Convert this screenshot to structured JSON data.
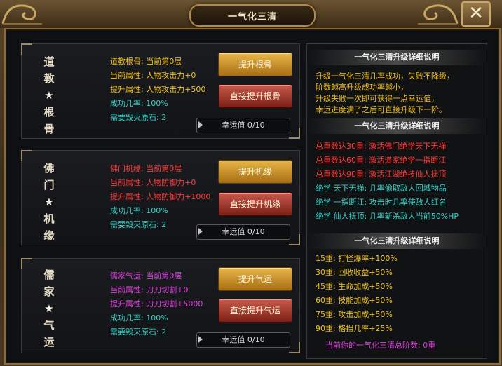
{
  "window": {
    "title": "一气化三清",
    "close_glyph": "✕"
  },
  "panels": [
    {
      "vertical_title": [
        "道",
        "教",
        "★",
        "根",
        "骨"
      ],
      "lines": [
        {
          "text": "道教根骨: 当前第0层",
          "color": "#f0c020"
        },
        {
          "text": "当前属性: 人物攻击力+0",
          "color": "#f0c020"
        },
        {
          "text": "提升属性: 人物攻击力+500",
          "color": "#f0c020"
        },
        {
          "text": "成功几率: 100%",
          "color": "#38d0c8"
        },
        {
          "text": "需要毁灭原石: 2",
          "color": "#38d0c8"
        }
      ],
      "btn_upgrade": "提升根骨",
      "btn_direct": "直接提升根骨",
      "luck": "幸运值 0/10"
    },
    {
      "vertical_title": [
        "佛",
        "门",
        "★",
        "机",
        "缘"
      ],
      "lines": [
        {
          "text": "佛门机缘: 当前第0层",
          "color": "#ff3a3a"
        },
        {
          "text": "当前属性: 人物防御力+0",
          "color": "#ff3a3a"
        },
        {
          "text": "提升属性: 人物防御力+1000",
          "color": "#ff3a3a"
        },
        {
          "text": "成功几率: 100%",
          "color": "#38d0c8"
        },
        {
          "text": "需要毁灭原石: 2",
          "color": "#38d0c8"
        }
      ],
      "btn_upgrade": "提升机缘",
      "btn_direct": "直接提升机缘",
      "luck": "幸运值 0/10"
    },
    {
      "vertical_title": [
        "儒",
        "家",
        "★",
        "气",
        "运"
      ],
      "lines": [
        {
          "text": "儒家气运: 当前第0层",
          "color": "#e040e0"
        },
        {
          "text": "当前属性: 刀刀切割+0",
          "color": "#e040e0"
        },
        {
          "text": "提升属性: 刀刀切割+5000",
          "color": "#e040e0"
        },
        {
          "text": "成功几率: 100%",
          "color": "#38d0c8"
        },
        {
          "text": "需要毁灭原石: 2",
          "color": "#38d0c8"
        }
      ],
      "btn_upgrade": "提升气运",
      "btn_direct": "直接提升气运",
      "luck": "幸运值 0/10"
    }
  ],
  "info": {
    "section1_title": "一气化三清升级详细说明",
    "section1_lines": [
      "升级一气化三清几率成功，失败不降级，",
      "阶数越高升级成功率越小，",
      "升级失败一次即可获得一点幸运值，",
      "幸运进度满了之后可直接升级下一阶。"
    ],
    "section1_color": "#f0c020",
    "section2_title": "一气化三清升级详细说明",
    "section2_red": [
      "总重数达30重:  激活佛门绝学天下无禅",
      "总重数达60重:  激活道家绝学一指断江",
      "总重数达90重:  激活江湖绝技仙人抚顶"
    ],
    "section2_red_color": "#ff3a3a",
    "section2_cyan": [
      "绝学 天下无禅:  几率偷取敌人回城物品",
      "绝学 一指断江:  攻击时几率使敌人红名",
      "绝学 仙人抚顶:  几率斩杀敌人当前50%HP"
    ],
    "section2_cyan_color": "#38d0c8",
    "section3_title": "一气化三清升级详细说明",
    "section3_lines": [
      "15重:  打怪爆率+100%",
      "30重:  回收收益+50%",
      "45重:  生命加成+50%",
      "60重:  技能加成+50%",
      "75重:  攻击加成+50%",
      "90重:  格挡几率+25%"
    ],
    "section3_color": "#f0c020",
    "total_text": "当前你的一气化三清总阶数: 0重",
    "total_color": "#e040e0"
  }
}
